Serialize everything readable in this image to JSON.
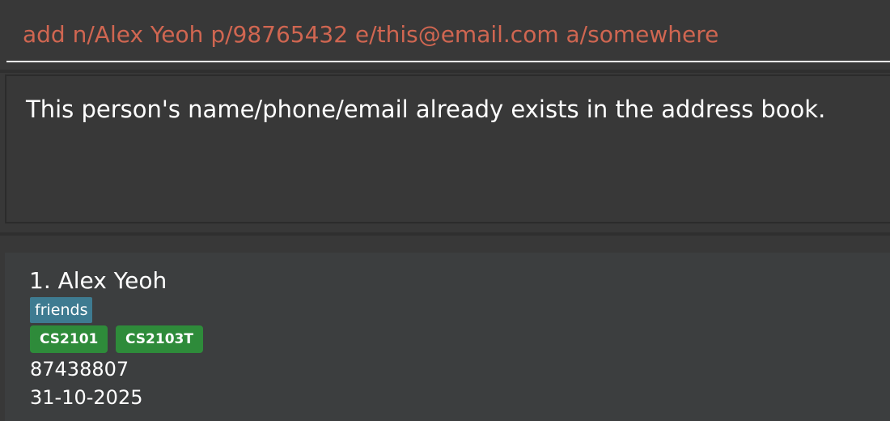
{
  "command_box": {
    "value": "add n/Alex Yeoh p/98765432 e/this@email.com a/somewhere"
  },
  "result_display": {
    "message": "This person's name/phone/email already exists in the address book."
  },
  "person_list": {
    "persons": [
      {
        "index_name": "1. Alex Yeoh",
        "tags": [
          "friends"
        ],
        "modules": [
          "CS2101",
          "CS2103T"
        ],
        "phone": "87438807",
        "date": "31-10-2025"
      }
    ]
  },
  "colors": {
    "command_text": "#d06651",
    "background": "#383838",
    "card_background": "#3c3e3f",
    "tag_friends": "#3e7b91",
    "tag_module": "#2e8b3a"
  }
}
